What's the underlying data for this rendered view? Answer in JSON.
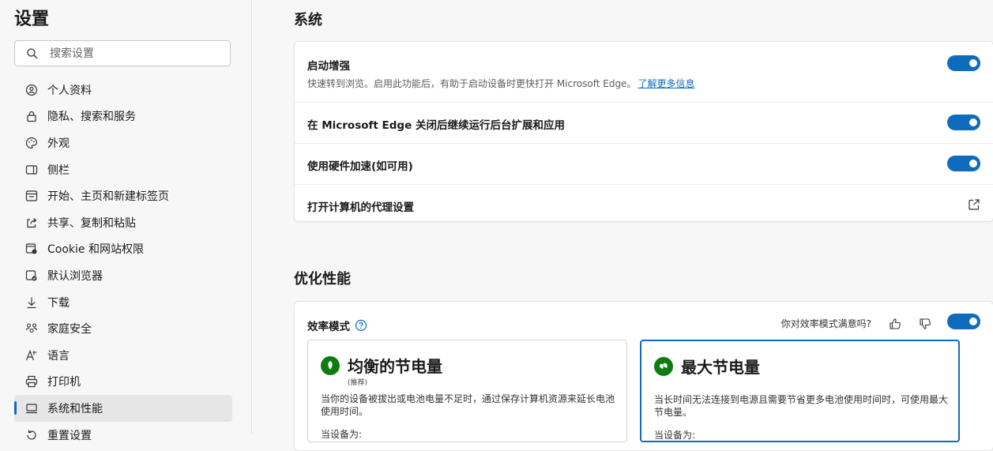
{
  "sidebar": {
    "title": "设置",
    "search_placeholder": "搜索设置",
    "items": [
      {
        "label": "个人资料",
        "icon": "profile-icon"
      },
      {
        "label": "隐私、搜索和服务",
        "icon": "lock-icon"
      },
      {
        "label": "外观",
        "icon": "palette-icon"
      },
      {
        "label": "侧栏",
        "icon": "sidebar-panel-icon"
      },
      {
        "label": "开始、主页和新建标签页",
        "icon": "home-tab-icon"
      },
      {
        "label": "共享、复制和粘贴",
        "icon": "share-icon"
      },
      {
        "label": "Cookie 和网站权限",
        "icon": "cookie-permissions-icon"
      },
      {
        "label": "默认浏览器",
        "icon": "default-browser-icon"
      },
      {
        "label": "下载",
        "icon": "download-icon"
      },
      {
        "label": "家庭安全",
        "icon": "family-icon"
      },
      {
        "label": "语言",
        "icon": "language-icon"
      },
      {
        "label": "打印机",
        "icon": "printer-icon"
      },
      {
        "label": "系统和性能",
        "icon": "system-icon",
        "active": true
      },
      {
        "label": "重置设置",
        "icon": "reset-icon"
      }
    ]
  },
  "system": {
    "title": "系统",
    "startup_boost": {
      "title": "启动增强",
      "desc": "快速转到浏览。启用此功能后，有助于启动设备时更快打开 Microsoft Edge。",
      "link": "了解更多信息",
      "enabled": true
    },
    "background_apps": {
      "title": "在 Microsoft Edge 关闭后继续运行后台扩展和应用",
      "enabled": true
    },
    "hardware_accel": {
      "title": "使用硬件加速(如可用)",
      "enabled": true
    },
    "proxy": {
      "title": "打开计算机的代理设置"
    }
  },
  "performance": {
    "title": "优化性能",
    "efficiency_mode": {
      "title": "效率模式",
      "feedback_question": "你对效率模式满意吗?",
      "enabled": true
    },
    "modes": [
      {
        "title": "均衡的节电量",
        "subtitle": "(推荐)",
        "desc": "当你的设备被拔出或电池电量不足时，通过保存计算机资源来延长电池使用时间。",
        "foot": "当设备为:",
        "selected": false
      },
      {
        "title": "最大节电量",
        "subtitle": "",
        "desc": "当长时间无法连接到电源且需要节省更多电池使用时间时，可使用最大节电量。",
        "foot": "当设备为:",
        "selected": true
      }
    ]
  },
  "colors": {
    "accent": "#0f6cbd",
    "leaf_green": "#107c10"
  }
}
